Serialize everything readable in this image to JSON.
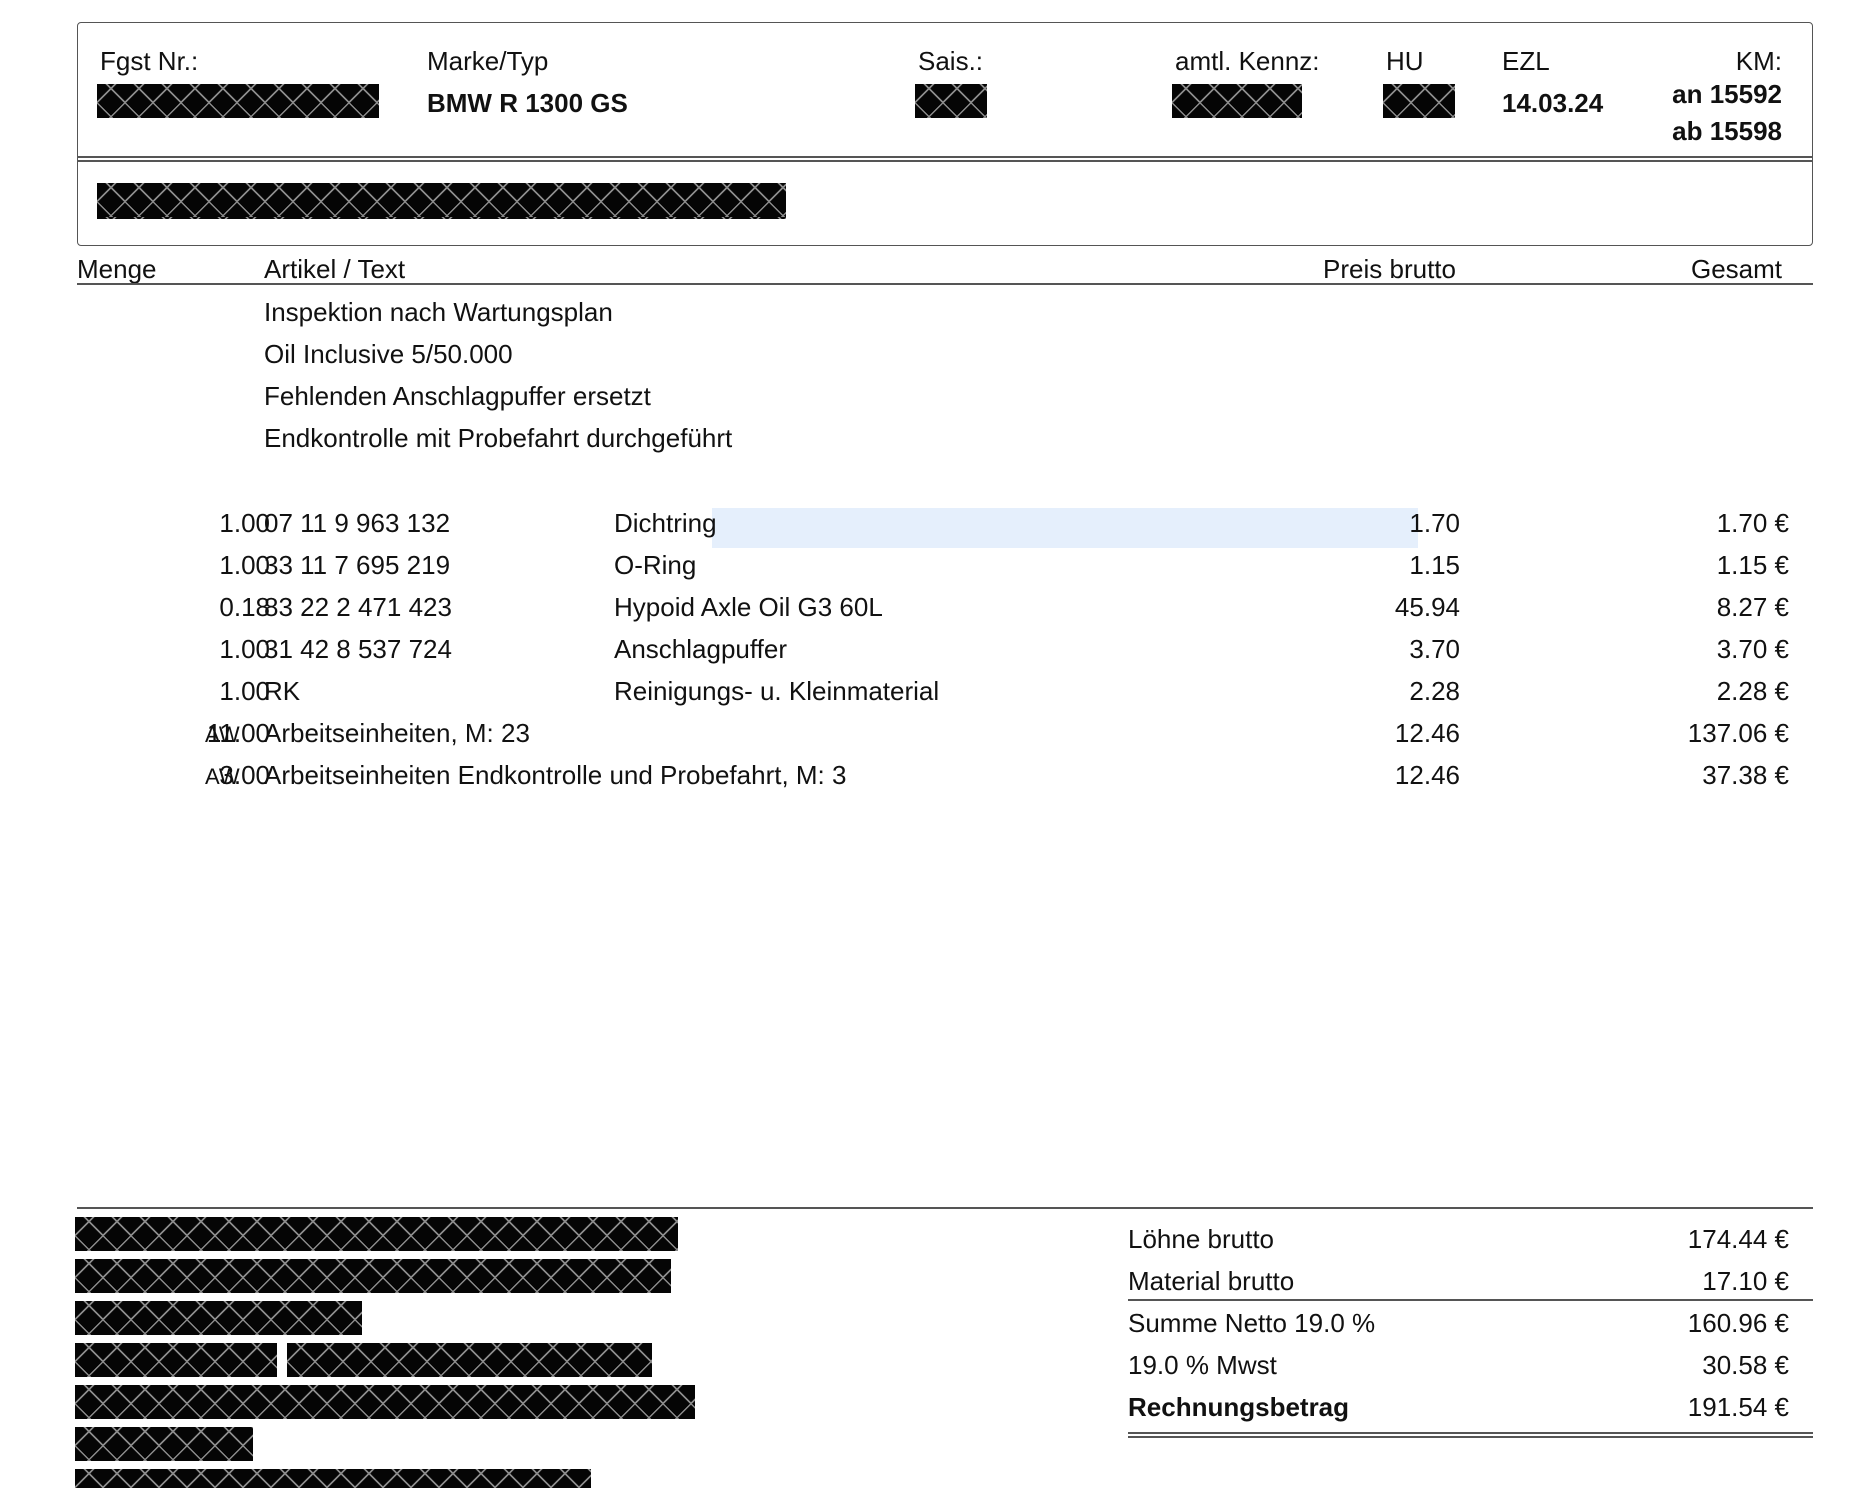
{
  "header": {
    "fgst_label": "Fgst Nr.:",
    "marke_label": "Marke/Typ",
    "marke_value": "BMW R 1300 GS",
    "sais_label": "Sais.:",
    "kennz_label": "amtl. Kennz:",
    "hu_label": "HU",
    "ezl_label": "EZL",
    "ezl_value": "14.03.24",
    "km_label": "KM:",
    "km_an": "an 15592",
    "km_ab": "ab 15598"
  },
  "columns": {
    "menge": "Menge",
    "artikel": "Artikel / Text",
    "preis": "Preis brutto",
    "gesamt": "Gesamt"
  },
  "descriptions": [
    "Inspektion nach Wartungsplan",
    "Oil Inclusive 5/50.000",
    "Fehlenden Anschlagpuffer ersetzt",
    "Endkontrolle mit Probefahrt durchgeführt"
  ],
  "items": [
    {
      "qty": "1.00",
      "unit": "",
      "article": "07 11 9 963 132",
      "name": "Dichtring",
      "price": "1.70",
      "total": "1.70 €"
    },
    {
      "qty": "1.00",
      "unit": "",
      "article": "33 11 7 695 219",
      "name": "O-Ring",
      "price": "1.15",
      "total": "1.15 €"
    },
    {
      "qty": "0.18",
      "unit": "",
      "article": "83 22 2 471 423",
      "name": "Hypoid Axle Oil G3 60L",
      "price": "45.94",
      "total": "8.27 €"
    },
    {
      "qty": "1.00",
      "unit": "",
      "article": "31 42 8 537 724",
      "name": "Anschlagpuffer",
      "price": "3.70",
      "total": "3.70 €"
    },
    {
      "qty": "1.00",
      "unit": "",
      "article": "RK",
      "name": "Reinigungs- u. Kleinmaterial",
      "price": "2.28",
      "total": "2.28 €"
    },
    {
      "qty": "11.00",
      "unit": "AW",
      "article": "Arbeitseinheiten, M: 23",
      "name": "",
      "price": "12.46",
      "total": "137.06 €"
    },
    {
      "qty": "3.00",
      "unit": "AW",
      "article": "Arbeitseinheiten  Endkontrolle und Probefahrt, M: 3",
      "name": "",
      "price": "12.46",
      "total": "37.38 €"
    }
  ],
  "summary": {
    "loehne_label": "Löhne brutto",
    "loehne_value": "174.44 €",
    "material_label": "Material brutto",
    "material_value": "17.10 €",
    "netto_label": "Summe Netto 19.0 %",
    "netto_value": "160.96 €",
    "mwst_label": "19.0 % Mwst",
    "mwst_value": "30.58 €",
    "rechnung_label": "Rechnungsbetrag",
    "rechnung_value": "191.54 €"
  }
}
